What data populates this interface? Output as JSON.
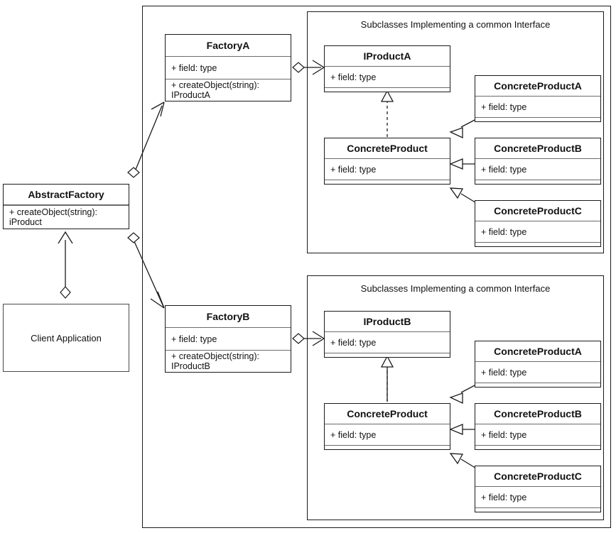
{
  "diagram": {
    "title_group_top": "Subclasses Implementing a common Interface",
    "title_group_bottom": "Subclasses Implementing a common Interface"
  },
  "client": {
    "label": "Client Application"
  },
  "abstract_factory": {
    "name": "AbstractFactory",
    "operation": "+ createObject(string): iProduct"
  },
  "factory_a": {
    "name": "FactoryA",
    "field": "+ field: type",
    "operation": "+ createObject(string): IProductA"
  },
  "factory_b": {
    "name": "FactoryB",
    "field": "+ field: type",
    "operation": "+ createObject(string): IProductB"
  },
  "group_top": {
    "interface": {
      "name": "IProductA",
      "field": "+ field: type"
    },
    "concrete_product": {
      "name": "ConcreteProduct",
      "field": "+ field: type"
    },
    "subclasses": [
      {
        "name": "ConcreteProductA",
        "field": "+ field: type"
      },
      {
        "name": "ConcreteProductB",
        "field": "+ field: type"
      },
      {
        "name": "ConcreteProductC",
        "field": "+ field: type"
      }
    ]
  },
  "group_bottom": {
    "interface": {
      "name": "IProductB",
      "field": "+ field: type"
    },
    "concrete_product": {
      "name": "ConcreteProduct",
      "field": "+ field: type"
    },
    "subclasses": [
      {
        "name": "ConcreteProductA",
        "field": "+ field: type"
      },
      {
        "name": "ConcreteProductB",
        "field": "+ field: type"
      },
      {
        "name": "ConcreteProductC",
        "field": "+ field: type"
      }
    ]
  },
  "colors": {
    "stroke": "#1a1a1a",
    "divider": "#6b6b6b",
    "background": "#ffffff"
  }
}
